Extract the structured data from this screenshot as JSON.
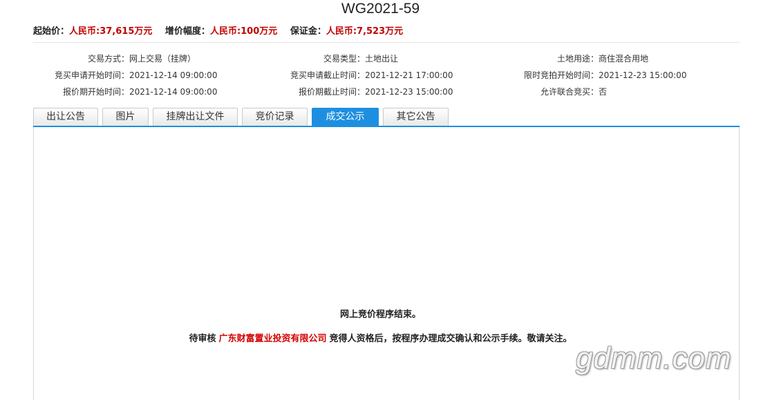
{
  "title": "WG2021-59",
  "prices": {
    "start_label": "起始价：",
    "start_value": "人民币:37,615万元",
    "increment_label": "增价幅度：",
    "increment_value": "人民币:100万元",
    "deposit_label": "保证金：",
    "deposit_value": "人民币:7,523万元"
  },
  "info": {
    "row1": {
      "c1_label": "交易方式：",
      "c1_value": "网上交易（挂牌）",
      "c2_label": "交易类型：",
      "c2_value": "土地出让",
      "c3_label": "土地用途：",
      "c3_value": "商住混合用地"
    },
    "row2": {
      "c1_label": "竞买申请开始时间：",
      "c1_value": "2021-12-14 09:00:00",
      "c2_label": "竞买申请截止时间：",
      "c2_value": "2021-12-21 17:00:00",
      "c3_label": "限时竞拍开始时间：",
      "c3_value": "2021-12-23 15:00:00"
    },
    "row3": {
      "c1_label": "报价期开始时间：",
      "c1_value": "2021-12-14 09:00:00",
      "c2_label": "报价期截止时间：",
      "c2_value": "2021-12-23 15:00:00",
      "c3_label": "允许联合竞买：",
      "c3_value": "否"
    }
  },
  "tabs": [
    "出让公告",
    "图片",
    "挂牌出让文件",
    "竞价记录",
    "成交公示",
    "其它公告"
  ],
  "active_tab": "成交公示",
  "message": {
    "line1": "网上竞价程序结束。",
    "line2_prefix": "待审核",
    "company": "广东财富置业投资有限公司",
    "line2_suffix": "竞得人资格后，按程序办理成交确认和公示手续。敬请关注。"
  },
  "watermark": "gdmm.com",
  "colors": {
    "accent": "#1e8fe0",
    "price_red": "#c00000",
    "company_red": "#d40000"
  }
}
